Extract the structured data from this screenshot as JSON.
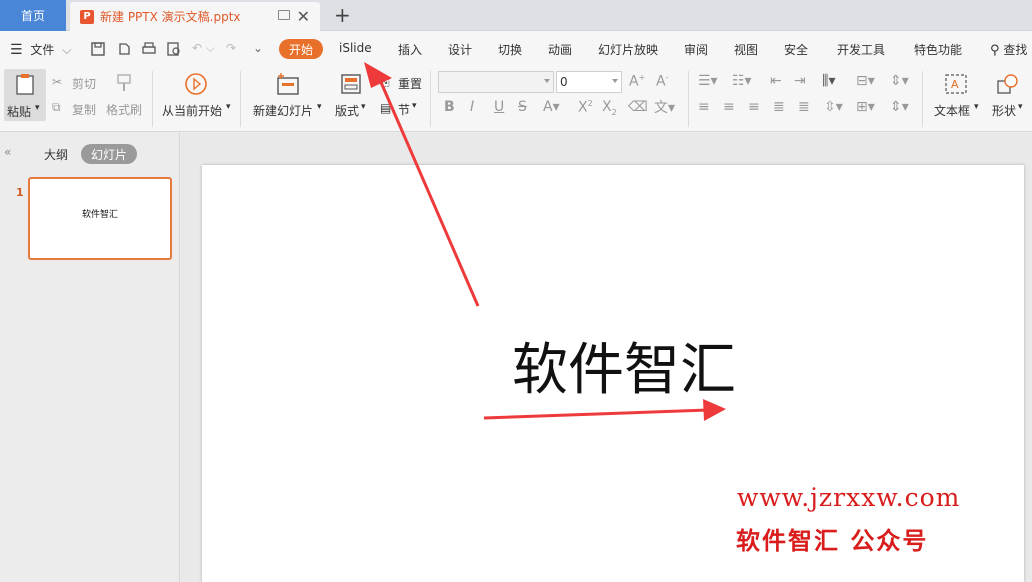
{
  "tabs": {
    "home": "首页",
    "doc_icon": "P",
    "doc_title": "新建 PPTX 演示文稿.pptx",
    "add": "+",
    "close": "✕"
  },
  "menu": {
    "file": "文件",
    "items": [
      "开始",
      "iSlide",
      "插入",
      "设计",
      "切换",
      "动画",
      "幻灯片放映",
      "审阅",
      "视图",
      "安全",
      "开发工具",
      "特色功能"
    ],
    "search": "查找"
  },
  "ribbon": {
    "paste": "粘贴",
    "cut": "剪切",
    "copy": "复制",
    "format_painter": "格式刷",
    "from_current": "从当前开始",
    "new_slide": "新建幻灯片",
    "layout": "版式",
    "reset": "重置",
    "section": "节",
    "font_name": "",
    "font_size": "0",
    "textbox": "文本框",
    "shape": "形状"
  },
  "left_panel": {
    "outline": "大纲",
    "slides": "幻灯片",
    "slide_number": "1",
    "thumb_text": "软件智汇"
  },
  "slide": {
    "title": "软件智汇",
    "watermark_url": "www.jzrxxw.com",
    "watermark_name": "软件智汇  公众号"
  },
  "colors": {
    "accent_orange": "#e8702a",
    "home_tab_blue": "#4a86d8",
    "arrow_red": "#ee3a3a",
    "watermark_red": "#d91c1c"
  }
}
